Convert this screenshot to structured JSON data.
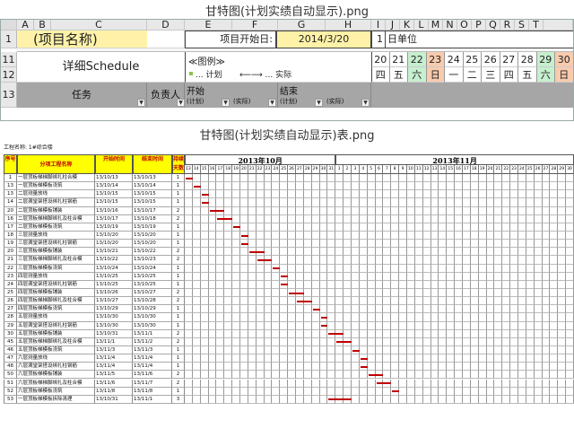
{
  "caption_top": "甘特图(计划实绩自动显示).png",
  "caption_bottom": "甘特图(计划实绩自动显示)表.png",
  "top": {
    "col_headers": [
      "A",
      "B",
      "C",
      "D",
      "E",
      "F",
      "G",
      "H",
      "I",
      "J",
      "K",
      "L",
      "M",
      "N",
      "O",
      "P",
      "Q",
      "R",
      "S",
      "T"
    ],
    "row_numbers": [
      "1",
      "11",
      "12",
      "13"
    ],
    "project_name": "(项目名称)",
    "start_label": "项目开始日:",
    "start_date": "2014/3/20",
    "unit_value": "1",
    "unit_label": "日单位",
    "schedule_title": "详细Schedule",
    "legend_title": "≪图例≫",
    "legend_plan": "... 计划",
    "legend_actual": "⟵⟶ ... 实际",
    "days": [
      "20",
      "21",
      "22",
      "23",
      "24",
      "25",
      "26",
      "27",
      "28",
      "29",
      "30"
    ],
    "weekdays": [
      "四",
      "五",
      "六",
      "日",
      "一",
      "二",
      "三",
      "四",
      "五",
      "六",
      "日"
    ],
    "h_task": "任务",
    "h_owner": "负责人",
    "h_start": "开始",
    "h_end": "结束",
    "h_plan": "(计划)",
    "h_actual": "(实际)",
    "h_plan2": "(计划)",
    "h_actual2": "(实际)",
    "colors": {
      "sat": "#c6efce",
      "sun": "#f8cbad",
      "yellow": "#fff2a8",
      "header_blue": "#dce6f1"
    }
  },
  "gantt": {
    "project_label": "工程名称: 1#综合楼",
    "h_no": "序号",
    "h_name": "分项工程名称",
    "h_start": "开始时间",
    "h_end": "结束时间",
    "h_dur": "持续天数",
    "month1": "2013年10月",
    "month2": "2013年11月",
    "days_oct": [
      "13",
      "14",
      "15",
      "16",
      "17",
      "18",
      "19",
      "20",
      "21",
      "22",
      "23",
      "24",
      "25",
      "26",
      "27",
      "28",
      "29",
      "30",
      "31"
    ],
    "days_nov": [
      "1",
      "2",
      "3",
      "4",
      "5",
      "6",
      "7",
      "8",
      "9",
      "10",
      "11",
      "12",
      "13",
      "14",
      "15",
      "16",
      "17",
      "18",
      "19",
      "20",
      "21",
      "22",
      "23",
      "24",
      "25",
      "26",
      "27",
      "28",
      "29",
      "30"
    ],
    "rows": [
      {
        "no": "1",
        "name": "一层顶板梯梯脚绑扎柱合模",
        "start": "13/10/13",
        "end": "13/10/13",
        "dur": "1"
      },
      {
        "no": "13",
        "name": "一层顶板梯模板浇筑",
        "start": "13/10/14",
        "end": "13/10/14",
        "dur": "1"
      },
      {
        "no": "13",
        "name": "二层测量放线",
        "start": "13/10/15",
        "end": "13/10/15",
        "dur": "1"
      },
      {
        "no": "14",
        "name": "二层满堂架搭设绑扎柱钢筋",
        "start": "13/10/15",
        "end": "13/10/15",
        "dur": "1"
      },
      {
        "no": "20",
        "name": "二层顶板梯模板铺装",
        "start": "13/10/16",
        "end": "13/10/17",
        "dur": "2"
      },
      {
        "no": "16",
        "name": "二层顶板梯梯脚绑扎及柱合模",
        "start": "13/10/17",
        "end": "13/10/18",
        "dur": "2"
      },
      {
        "no": "17",
        "name": "二层顶板梯模板浇筑",
        "start": "13/10/19",
        "end": "13/10/19",
        "dur": "1"
      },
      {
        "no": "18",
        "name": "三层测量放线",
        "start": "13/10/20",
        "end": "13/10/20",
        "dur": "1"
      },
      {
        "no": "19",
        "name": "三层满堂架搭设绑扎柱钢筋",
        "start": "13/10/20",
        "end": "13/10/20",
        "dur": "1"
      },
      {
        "no": "20",
        "name": "三层顶板梯模板铺装",
        "start": "13/10/21",
        "end": "13/10/22",
        "dur": "2"
      },
      {
        "no": "21",
        "name": "三层顶板梯梯脚绑扎及柱合模",
        "start": "13/10/22",
        "end": "13/10/23",
        "dur": "2"
      },
      {
        "no": "22",
        "name": "三层顶板梯模板浇筑",
        "start": "13/10/24",
        "end": "13/10/24",
        "dur": "1"
      },
      {
        "no": "23",
        "name": "四层测量放线",
        "start": "13/10/25",
        "end": "13/10/25",
        "dur": "1"
      },
      {
        "no": "24",
        "name": "四层满堂架搭设绑扎柱钢筋",
        "start": "13/10/25",
        "end": "13/10/25",
        "dur": "1"
      },
      {
        "no": "25",
        "name": "四层顶板梯模板铺装",
        "start": "13/10/26",
        "end": "13/10/27",
        "dur": "2"
      },
      {
        "no": "26",
        "name": "四层顶板梯梯脚绑扎及柱合模",
        "start": "13/10/27",
        "end": "13/10/28",
        "dur": "2"
      },
      {
        "no": "27",
        "name": "四层顶板梯模板浇筑",
        "start": "13/10/29",
        "end": "13/10/29",
        "dur": "1"
      },
      {
        "no": "28",
        "name": "五层测量放线",
        "start": "13/10/30",
        "end": "13/10/30",
        "dur": "1"
      },
      {
        "no": "29",
        "name": "五层满堂架搭设绑扎柱钢筋",
        "start": "13/10/30",
        "end": "13/10/30",
        "dur": "1"
      },
      {
        "no": "30",
        "name": "五层顶板梯模板铺装",
        "start": "13/10/31",
        "end": "13/11/1",
        "dur": "2"
      },
      {
        "no": "45",
        "name": "五层顶板梯梯脚绑扎及柱合模",
        "start": "13/11/1",
        "end": "13/11/2",
        "dur": "2"
      },
      {
        "no": "46",
        "name": "五层顶板梯模板浇筑",
        "start": "13/11/3",
        "end": "13/11/3",
        "dur": "1"
      },
      {
        "no": "47",
        "name": "六层测量放线",
        "start": "13/11/4",
        "end": "13/11/4",
        "dur": "1"
      },
      {
        "no": "48",
        "name": "六层满堂架搭设绑扎柱钢筋",
        "start": "13/11/4",
        "end": "13/11/4",
        "dur": "1"
      },
      {
        "no": "50",
        "name": "六层顶板梯模板铺装",
        "start": "13/11/5",
        "end": "13/11/6",
        "dur": "2"
      },
      {
        "no": "51",
        "name": "六层顶板梯梯脚绑扎及柱合模",
        "start": "13/11/6",
        "end": "13/11/7",
        "dur": "2"
      },
      {
        "no": "52",
        "name": "六层顶板梯模板浇筑",
        "start": "13/11/8",
        "end": "13/11/8",
        "dur": "1"
      },
      {
        "no": "53",
        "name": "一层顶板梯模板拆除清理",
        "start": "13/10/31",
        "end": "13/11/1",
        "dur": "3"
      }
    ],
    "bars": [
      {
        "s": 0,
        "d": 1
      },
      {
        "s": 1,
        "d": 1
      },
      {
        "s": 2,
        "d": 1
      },
      {
        "s": 2,
        "d": 1
      },
      {
        "s": 3,
        "d": 2
      },
      {
        "s": 4,
        "d": 2
      },
      {
        "s": 6,
        "d": 1
      },
      {
        "s": 7,
        "d": 1
      },
      {
        "s": 7,
        "d": 1
      },
      {
        "s": 8,
        "d": 2
      },
      {
        "s": 9,
        "d": 2
      },
      {
        "s": 11,
        "d": 1
      },
      {
        "s": 12,
        "d": 1
      },
      {
        "s": 12,
        "d": 1
      },
      {
        "s": 13,
        "d": 2
      },
      {
        "s": 14,
        "d": 2
      },
      {
        "s": 16,
        "d": 1
      },
      {
        "s": 17,
        "d": 1
      },
      {
        "s": 17,
        "d": 1
      },
      {
        "s": 18,
        "d": 2
      },
      {
        "s": 19,
        "d": 2
      },
      {
        "s": 21,
        "d": 1
      },
      {
        "s": 22,
        "d": 1
      },
      {
        "s": 22,
        "d": 1
      },
      {
        "s": 23,
        "d": 2
      },
      {
        "s": 24,
        "d": 2
      },
      {
        "s": 26,
        "d": 1
      },
      {
        "s": 18,
        "d": 3
      }
    ],
    "bar_color": "#c00000"
  }
}
